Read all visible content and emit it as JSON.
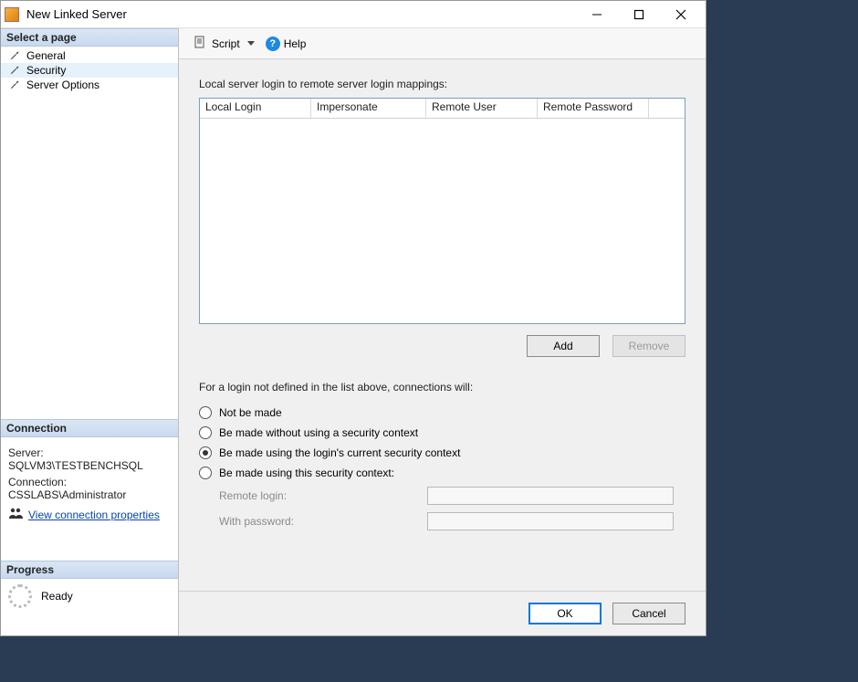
{
  "window": {
    "title": "New Linked Server"
  },
  "sidebar": {
    "select_page_header": "Select a page",
    "items": [
      {
        "label": "General"
      },
      {
        "label": "Security"
      },
      {
        "label": "Server Options"
      }
    ],
    "connection_header": "Connection",
    "server_label": "Server:",
    "server_value": "SQLVM3\\TESTBENCHSQL",
    "connection_label": "Connection:",
    "connection_value": "CSSLABS\\Administrator",
    "view_conn_props": "View connection properties",
    "progress_header": "Progress",
    "progress_value": "Ready"
  },
  "toolbar": {
    "script_label": "Script",
    "help_label": "Help"
  },
  "main": {
    "mappings_label": "Local server login to remote server login mappings:",
    "columns": {
      "local_login": "Local Login",
      "impersonate": "Impersonate",
      "remote_user": "Remote User",
      "remote_password": "Remote Password"
    },
    "add_label": "Add",
    "remove_label": "Remove",
    "undef_label": "For a login not defined in the list above, connections will:",
    "radios": {
      "not_be_made": "Not be made",
      "no_security": "Be made without using a security context",
      "current_security": "Be made using the login's current security context",
      "this_security": "Be made using this security context:"
    },
    "remote_login_label": "Remote login:",
    "with_password_label": "With password:"
  },
  "footer": {
    "ok_label": "OK",
    "cancel_label": "Cancel"
  }
}
